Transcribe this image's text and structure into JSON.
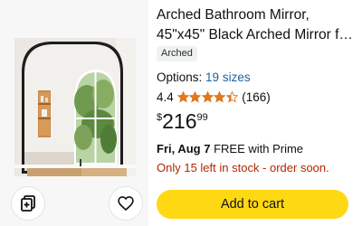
{
  "product": {
    "title_line1": "Arched Bathroom Mirror,",
    "title_line2": "45\"x45\" Black Arched Mirror f…",
    "badge": "Arched",
    "options_label": "Options:",
    "options_value": "19 sizes",
    "rating": "4.4",
    "rating_value": 4.4,
    "rating_max": 5,
    "review_count": "(166)",
    "price_symbol": "$",
    "price_whole": "216",
    "price_fraction": "99",
    "delivery_date": "Fri, Aug 7",
    "delivery_text": " FREE with Prime",
    "stock_text": "Only 15 left in stock - order soon."
  },
  "actions": {
    "add_to_cart": "Add to cart",
    "compare_icon": "compare-icon",
    "wishlist_icon": "heart-icon"
  },
  "colors": {
    "button_yellow": "#ffd814",
    "star_orange": "#de7921",
    "link_blue": "#2162a1",
    "stock_red": "#b12704",
    "badge_bg": "#f0f2f2"
  }
}
